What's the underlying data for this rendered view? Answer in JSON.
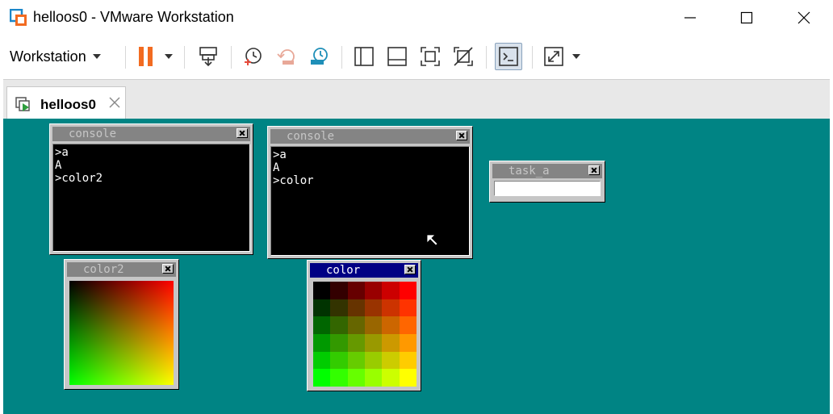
{
  "window": {
    "title": "helloos0 - VMware Workstation",
    "icon": "vmware-logo-icon",
    "controls": [
      "minimize-icon",
      "maximize-icon",
      "close-icon"
    ]
  },
  "toolbar": {
    "menu_label": "Workstation",
    "buttons": [
      "pause-icon",
      "send-ctrl-alt-del-icon",
      "snapshot-take-icon",
      "snapshot-revert-icon",
      "snapshot-manager-icon",
      "library-view-icon",
      "thumbnail-bar-icon",
      "full-screen-icon",
      "unity-icon",
      "console-view-icon",
      "stretch-guest-icon"
    ],
    "accent_orange": "#f26b21"
  },
  "tabs": [
    {
      "label": "helloos0",
      "icon": "vm-running-icon",
      "close": "close-tab-icon"
    }
  ],
  "vm": {
    "background": "#008484",
    "windows": {
      "console_left": {
        "title": "console",
        "lines": [
          ">a",
          "A",
          ">color2"
        ]
      },
      "console_right": {
        "title": "console",
        "lines": [
          ">a",
          "A",
          ">color"
        ]
      },
      "task_a": {
        "title": "task_a",
        "input_value": ""
      },
      "color2": {
        "title": "color2"
      },
      "color": {
        "title": "color",
        "grid_colors": [
          [
            "#000000",
            "#330000",
            "#660000",
            "#990000",
            "#cc0000",
            "#ff0000"
          ],
          [
            "#003300",
            "#333300",
            "#663300",
            "#993300",
            "#cc3300",
            "#ff3300"
          ],
          [
            "#006600",
            "#336600",
            "#666600",
            "#996600",
            "#cc6600",
            "#ff6600"
          ],
          [
            "#009900",
            "#339900",
            "#669900",
            "#999900",
            "#cc9900",
            "#ff9900"
          ],
          [
            "#00cc00",
            "#33cc00",
            "#66cc00",
            "#99cc00",
            "#cccc00",
            "#ffcc00"
          ],
          [
            "#00ff00",
            "#33ff00",
            "#66ff00",
            "#99ff00",
            "#ccff00",
            "#ffff00"
          ]
        ]
      }
    }
  }
}
